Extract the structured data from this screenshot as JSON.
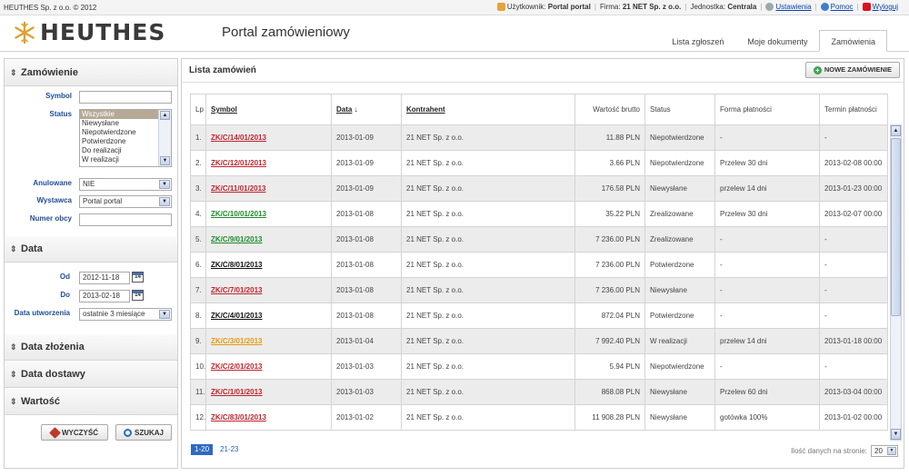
{
  "topbar": {
    "copyright": "HEUTHES Sp. z o.o. © 2012",
    "user_label": "Użytkownik:",
    "user_name": "Portal portal",
    "firm_label": "Firma:",
    "firm_name": "21 NET Sp. z o.o.",
    "unit_label": "Jednostka:",
    "unit_name": "Centrala",
    "settings": "Ustawienia",
    "help": "Pomoc",
    "logout": "Wyloguj"
  },
  "header": {
    "logo_text": "HEUTHES",
    "portal_title": "Portal zamówieniowy",
    "tabs": [
      {
        "label": "Lista zgłoszeń"
      },
      {
        "label": "Moje dokumenty"
      },
      {
        "label": "Zamówienia"
      }
    ]
  },
  "sidebar": {
    "section_order": "Zamówienie",
    "symbol_label": "Symbol",
    "symbol_value": "",
    "status_label": "Status",
    "status_options": [
      "Wszystkie",
      "Niewysłane",
      "Niepotwierdzone",
      "Potwierdzone",
      "Do realizacji",
      "W realizacji"
    ],
    "cancelled_label": "Anulowane",
    "cancelled_value": "NIE",
    "issuer_label": "Wystawca",
    "issuer_value": "Portal portal",
    "external_label": "Numer obcy",
    "external_value": "",
    "section_date": "Data",
    "from_label": "Od",
    "from_value": "2012-11-18",
    "to_label": "Do",
    "to_value": "2013-02-18",
    "created_label": "Data utworzenia",
    "created_value": "ostatnie 3 miesiące",
    "cal_day": "14",
    "section_placed": "Data złożenia",
    "section_delivery": "Data dostawy",
    "section_value": "Wartość",
    "clear_button": "WYCZYŚĆ",
    "search_button": "SZUKAJ"
  },
  "main": {
    "title": "Lista zamówień",
    "new_order_button": "NOWE ZAMÓWIENIE",
    "columns": {
      "lp": "Lp",
      "symbol": "Symbol",
      "date": "Data",
      "date_sort": "↓",
      "contractor": "Kontrahent",
      "gross": "Wartość brutto",
      "status": "Status",
      "payment": "Forma płatności",
      "due": "Termin płatności"
    },
    "rows": [
      {
        "lp": "1.",
        "symbol": "ZK/C/14/01/2013",
        "color": "red",
        "date": "2013-01-09",
        "contractor": "21 NET Sp. z o.o.",
        "gross": "11.88 PLN",
        "status": "Niepotwierdzone",
        "payment": "-",
        "due": "-"
      },
      {
        "lp": "2.",
        "symbol": "ZK/C/12/01/2013",
        "color": "red",
        "date": "2013-01-09",
        "contractor": "21 NET Sp. z o.o.",
        "gross": "3.66 PLN",
        "status": "Niepotwierdzone",
        "payment": "Przelew 30 dni",
        "due": "2013-02-08 00:00"
      },
      {
        "lp": "3.",
        "symbol": "ZK/C/11/01/2013",
        "color": "red",
        "date": "2013-01-09",
        "contractor": "21 NET Sp. z o.o.",
        "gross": "176.58 PLN",
        "status": "Niewysłane",
        "payment": "przelew 14 dni",
        "due": "2013-01-23 00:00"
      },
      {
        "lp": "4.",
        "symbol": "ZK/C/10/01/2013",
        "color": "green",
        "date": "2013-01-08",
        "contractor": "21 NET Sp. z o.o.",
        "gross": "35.22 PLN",
        "status": "Zrealizowane",
        "payment": "Przelew 30 dni",
        "due": "2013-02-07 00:00"
      },
      {
        "lp": "5.",
        "symbol": "ZK/C/9/01/2013",
        "color": "green",
        "date": "2013-01-08",
        "contractor": "21 NET Sp. z o.o.",
        "gross": "7 236.00 PLN",
        "status": "Zrealizowane",
        "payment": "-",
        "due": "-"
      },
      {
        "lp": "6.",
        "symbol": "ZK/C/8/01/2013",
        "color": "black",
        "date": "2013-01-08",
        "contractor": "21 NET Sp. z o.o.",
        "gross": "7 236.00 PLN",
        "status": "Potwierdzone",
        "payment": "-",
        "due": "-"
      },
      {
        "lp": "7.",
        "symbol": "ZK/C/7/01/2013",
        "color": "red",
        "date": "2013-01-08",
        "contractor": "21 NET Sp. z o.o.",
        "gross": "7 236.00 PLN",
        "status": "Niewysłane",
        "payment": "-",
        "due": "-"
      },
      {
        "lp": "8.",
        "symbol": "ZK/C/4/01/2013",
        "color": "black",
        "date": "2013-01-08",
        "contractor": "21 NET Sp. z o.o.",
        "gross": "872.04 PLN",
        "status": "Potwierdzone",
        "payment": "-",
        "due": "-"
      },
      {
        "lp": "9.",
        "symbol": "ZK/C/3/01/2013",
        "color": "orange",
        "date": "2013-01-04",
        "contractor": "21 NET Sp. z o.o.",
        "gross": "7 992.40 PLN",
        "status": "W realizacji",
        "payment": "przelew 14 dni",
        "due": "2013-01-18 00:00"
      },
      {
        "lp": "10.",
        "symbol": "ZK/C/2/01/2013",
        "color": "red",
        "date": "2013-01-03",
        "contractor": "21 NET Sp. z o.o.",
        "gross": "5.94 PLN",
        "status": "Niepotwierdzone",
        "payment": "-",
        "due": "-"
      },
      {
        "lp": "11.",
        "symbol": "ZK/C/1/01/2013",
        "color": "red",
        "date": "2013-01-03",
        "contractor": "21 NET Sp. z o.o.",
        "gross": "868.08 PLN",
        "status": "Niewysłane",
        "payment": "Przelew 60 dni",
        "due": "2013-03-04 00:00"
      },
      {
        "lp": "12.",
        "symbol": "ZK/C/83/01/2013",
        "color": "red",
        "date": "2013-01-02",
        "contractor": "21 NET Sp. z o.o.",
        "gross": "11 908.28 PLN",
        "status": "Niewysłane",
        "payment": "gotówka 100%",
        "due": "2013-01-02 00:00"
      }
    ],
    "pages": [
      "1-20",
      "21-23"
    ],
    "per_page_label": "Ilość danych na stronie:",
    "per_page_value": "20"
  },
  "colors": {
    "red": "#c0232c",
    "green": "#1f8b2e",
    "black": "#111111",
    "orange": "#e69a10",
    "link": "#1f4c9a"
  }
}
